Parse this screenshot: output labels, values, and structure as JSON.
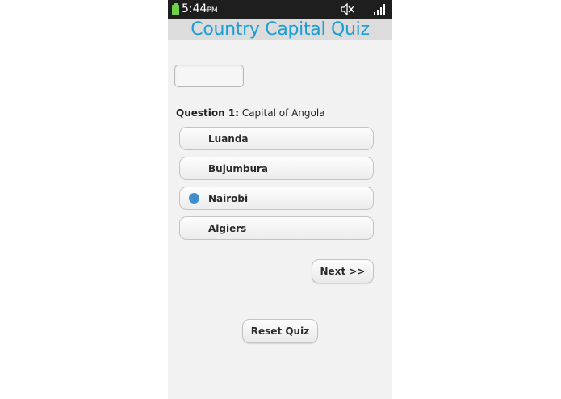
{
  "status_bar": {
    "time": "5:44",
    "ampm": "PM",
    "battery_color": "#6fd24a",
    "icons": [
      "battery-icon",
      "mute-icon",
      "signal-icon"
    ]
  },
  "app": {
    "title": "Country Capital Quiz",
    "title_color": "#1a9ed7"
  },
  "answer_box": {
    "value": ""
  },
  "question": {
    "number_label": "Question 1:",
    "text": "Capital of Angola"
  },
  "options": [
    {
      "label": "Luanda",
      "selected": false
    },
    {
      "label": "Bujumbura",
      "selected": false
    },
    {
      "label": "Nairobi",
      "selected": true
    },
    {
      "label": "Algiers",
      "selected": false
    }
  ],
  "selected_color": "#3f8fcf",
  "buttons": {
    "next_label": "Next >>",
    "reset_label": "Reset Quiz"
  }
}
